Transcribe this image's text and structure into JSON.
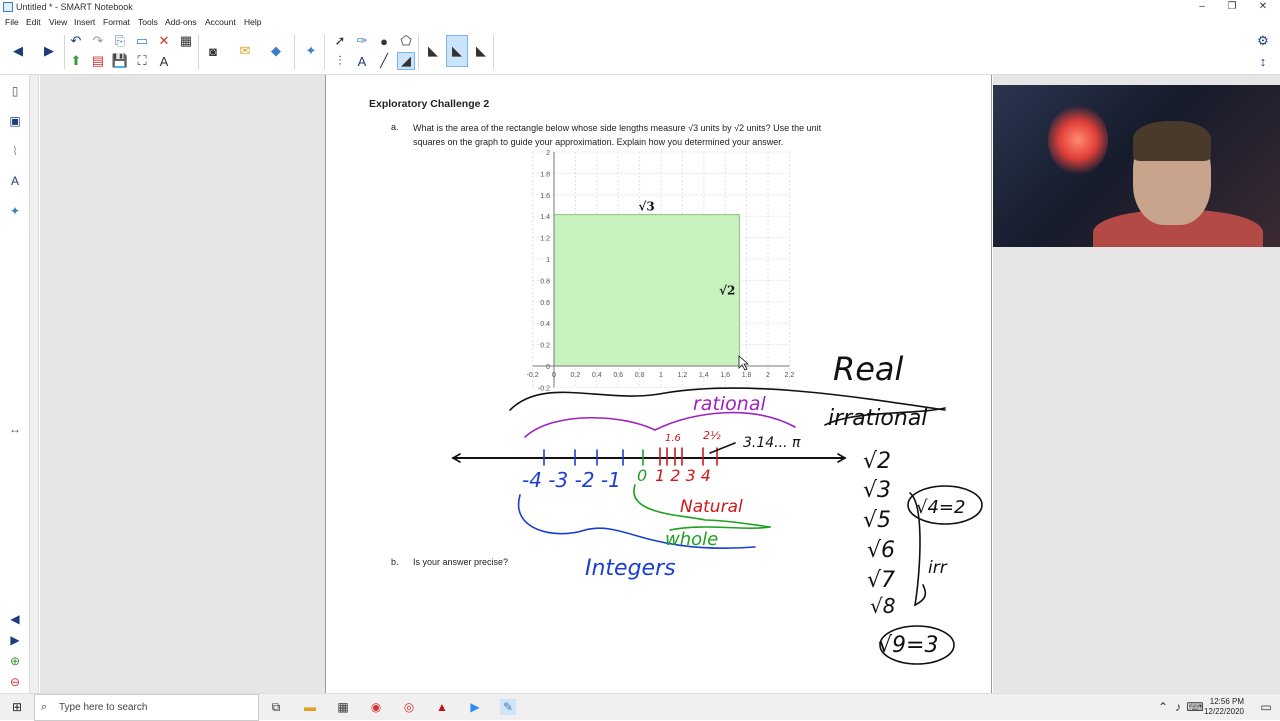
{
  "window": {
    "title": "Untitled * - SMART Notebook"
  },
  "menu": [
    "File",
    "Edit",
    "View",
    "Insert",
    "Format",
    "Tools",
    "Add-ons",
    "Account",
    "Help"
  ],
  "page": {
    "heading": "Exploratory Challenge 2",
    "qa_label": "a.",
    "qa_text_1": "What is the area of the rectangle below whose side lengths measure √3 units by √2 units?  Use the unit",
    "qa_text_2": "squares on the graph to guide your approximation.  Explain how you determined your answer.",
    "qb_label": "b.",
    "qb_text": "Is your answer precise?"
  },
  "graph": {
    "y_ticks": [
      "2",
      "1.8",
      "1.6",
      "1.4",
      "1.2",
      "1",
      "0.8",
      "0.6",
      "0.4",
      "0.2",
      "0",
      "-0.2"
    ],
    "x_ticks": [
      "-0.2",
      "0",
      "0.2",
      "0.4",
      "0.6",
      "0.8",
      "1",
      "1.2",
      "1.4",
      "1.6",
      "1.8",
      "2",
      "2.2"
    ],
    "width_label": "√3",
    "height_label": "√2",
    "rect_width": 1.732,
    "rect_height": 1.414,
    "fill_color": "#c6f2bd"
  },
  "annotations": {
    "real": "Real",
    "irrational": "irrational",
    "rational": "rational",
    "natural": "Natural",
    "whole": "whole",
    "integers": "Integers",
    "pi_approx": "3.14... π",
    "marks_small": "1.6",
    "marks_small2": "2½",
    "number_labels": "-4 -3 -2 -1",
    "zero": "0",
    "pos_labels": "1 2 3 4",
    "roots": [
      "√2",
      "√3",
      "√5",
      "√6",
      "√7",
      "√8"
    ],
    "irr": "irr",
    "root4": "√4=2",
    "root9": "√9=3"
  },
  "taskbar": {
    "search_placeholder": "Type here to search",
    "time": "12:56 PM",
    "date": "12/22/2020"
  },
  "colors": {
    "purple": "#a020c0",
    "red": "#d01818",
    "green": "#20a020",
    "blue": "#1a3fd0",
    "black": "#111111"
  }
}
